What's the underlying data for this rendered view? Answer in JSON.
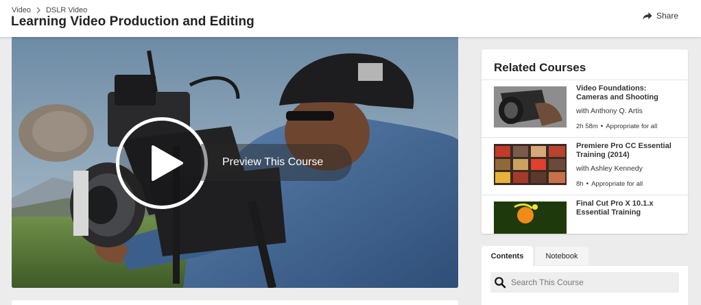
{
  "header": {
    "breadcrumb": [
      "Video",
      "DSLR Video"
    ],
    "title": "Learning Video Production and Editing",
    "share_label": "Share"
  },
  "video": {
    "preview_label": "Preview This Course"
  },
  "related": {
    "title": "Related Courses",
    "courses": [
      {
        "title": "Video Foundations: Cameras and Shooting",
        "author": "with Anthony Q. Artis",
        "duration": "2h 58m",
        "level": "Appropriate for all"
      },
      {
        "title": "Premiere Pro CC Essential Training (2014)",
        "author": "with Ashley Kennedy",
        "duration": "8h",
        "level": "Appropriate for all"
      },
      {
        "title": "Final Cut Pro X 10.1.x Essential Training",
        "author": "",
        "duration": "",
        "level": ""
      }
    ]
  },
  "tabs": {
    "contents": "Contents",
    "notebook": "Notebook"
  },
  "search": {
    "placeholder": "Search This Course"
  },
  "icons": {
    "share": "share-icon",
    "play": "play-icon",
    "search": "search-icon",
    "chevron": "chevron-right-icon"
  },
  "colors": {
    "header_bg": "#ffffff",
    "page_bg": "#ececec",
    "accent_text": "#222222"
  }
}
